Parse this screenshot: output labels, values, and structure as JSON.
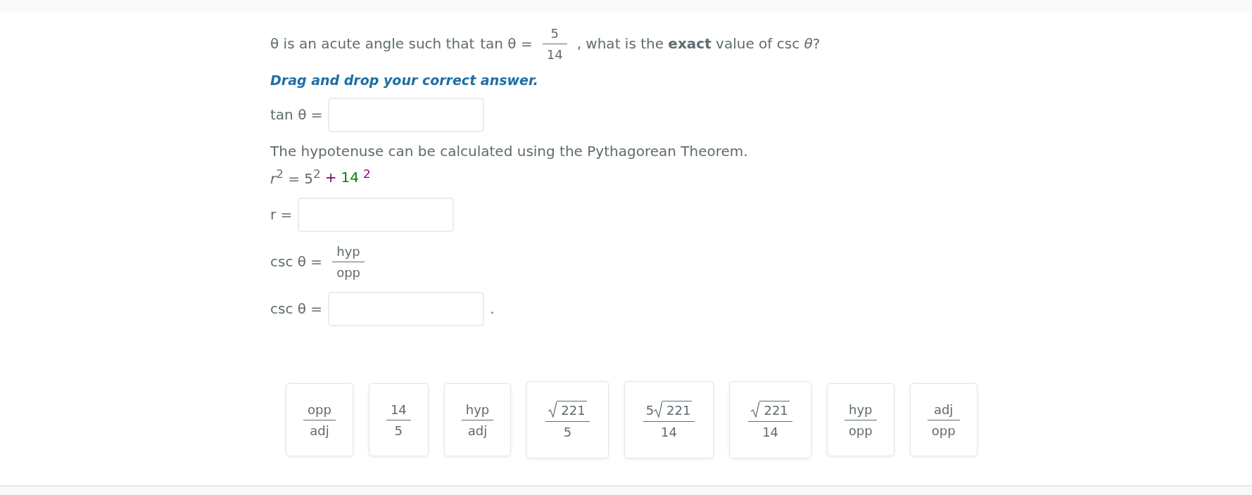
{
  "question": {
    "prefix": "θ is an acute angle such that",
    "lhs": "tan θ =",
    "numerator": "5",
    "denominator": "14",
    "suffix": ", what is the **exact** value of csc *θ*?"
  },
  "instruction": "Drag and drop your correct answer.",
  "steps": [
    {
      "kind": "blank",
      "label": "tan  θ ="
    },
    {
      "kind": "text",
      "text": "The hypotenuse can be calculated using the Pythagorean Theorem."
    },
    {
      "kind": "equation",
      "segments": [
        {
          "text": "*r*$^{2}$ = 5$^{2}$",
          "color": "#5f6b6f"
        },
        {
          "text": "+",
          "color": "#800080"
        },
        {
          "text": "14",
          "color": "#008000"
        },
        {
          "text": "$^{2}$",
          "color": "#800080"
        }
      ]
    },
    {
      "kind": "blank",
      "label": "r ="
    },
    {
      "kind": "fraction",
      "label": "csc  θ =",
      "numerator": "hyp",
      "denominator": "opp"
    },
    {
      "kind": "blank",
      "label": "csc  θ =",
      "suffix": "."
    }
  ],
  "tiles": [
    {
      "kind": "plain",
      "numerator": "opp",
      "denominator": "adj"
    },
    {
      "kind": "plain",
      "numerator": "14",
      "denominator": "5"
    },
    {
      "kind": "plain",
      "numerator": "hyp",
      "denominator": "adj"
    },
    {
      "kind": "radical",
      "radicand": "221",
      "denominator": "5"
    },
    {
      "kind": "radical",
      "coefficient": "5",
      "radicand": "221",
      "denominator": "14"
    },
    {
      "kind": "radical",
      "radicand": "221",
      "denominator": "14"
    },
    {
      "kind": "plain",
      "numerator": "hyp",
      "denominator": "opp"
    },
    {
      "kind": "plain",
      "numerator": "adj",
      "denominator": "opp"
    }
  ]
}
